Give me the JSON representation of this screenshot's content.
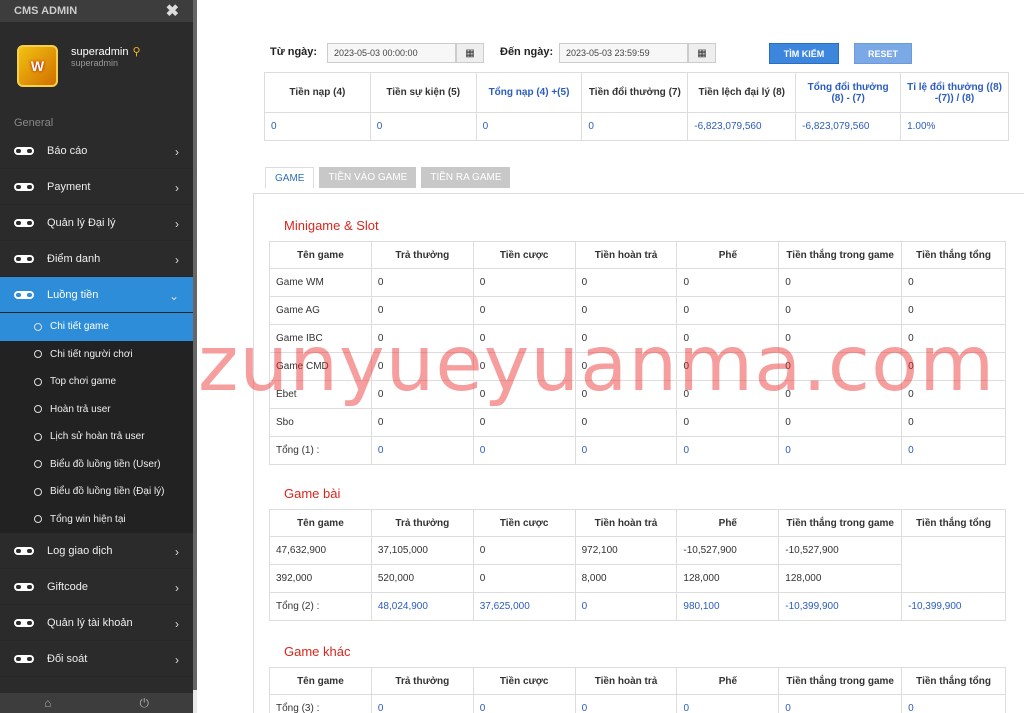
{
  "app": {
    "title": "CMS ADMIN",
    "close_icon": "✖"
  },
  "user": {
    "name": "superadmin",
    "role": "superadmin",
    "logo_text": "W",
    "key_icon": "key-icon"
  },
  "sidebar": {
    "section": "General",
    "items": [
      {
        "label": "Báo cáo"
      },
      {
        "label": "Payment"
      },
      {
        "label": "Quản lý Đại lý"
      },
      {
        "label": "Điểm danh"
      },
      {
        "label": "Luồng tiền"
      }
    ],
    "subitems": [
      {
        "label": "Chi tiết game"
      },
      {
        "label": "Chi tiết người chơi"
      },
      {
        "label": "Top chơi game"
      },
      {
        "label": "Hoàn trả user"
      },
      {
        "label": "Lịch sử hoàn trả user"
      },
      {
        "label": "Biểu đồ luồng tiền (User)"
      },
      {
        "label": "Biểu đồ luồng tiền (Đại lý)"
      },
      {
        "label": "Tổng win hiện tại"
      }
    ],
    "items2": [
      {
        "label": "Log giao dịch"
      },
      {
        "label": "Giftcode"
      },
      {
        "label": "Quản lý tài khoản"
      },
      {
        "label": "Đối soát"
      }
    ],
    "footer": {
      "home": "⌂",
      "power": "⏻"
    }
  },
  "filter": {
    "from_label": "Từ ngày:",
    "from_value": "2023-05-03 00:00:00",
    "to_label": "Đến ngày:",
    "to_value": "2023-05-03 23:59:59",
    "search_btn": "TÌM KIẾM",
    "reset_btn": "RESET",
    "cal_icon": "▦"
  },
  "summary": {
    "headers": [
      "Tiền nạp (4)",
      "Tiền sự kiện (5)",
      "Tổng nạp (4) +(5)",
      "Tiền đổi thưởng (7)",
      "Tiền lệch đại lý (8)",
      "Tổng đổi thưởng (8) - (7)",
      "Tỉ lệ đổi thưởng ((8) -(7)) / (8)"
    ],
    "values": [
      "0",
      "0",
      "0",
      "0",
      "-6,823,079,560",
      "-6,823,079,560",
      "1.00%"
    ]
  },
  "tabs": [
    "GAME",
    "TIỀN VÀO GAME",
    "TIỀN RA GAME"
  ],
  "columns": [
    "Tên game",
    "Trả thưởng",
    "Tiền cược",
    "Tiền hoàn trả",
    "Phế",
    "Tiền thắng trong game",
    "Tiền thắng tổng"
  ],
  "minigame": {
    "title": "Minigame & Slot",
    "rows": [
      [
        "Game WM",
        "0",
        "0",
        "0",
        "0",
        "0",
        "0"
      ],
      [
        "Game AG",
        "0",
        "0",
        "0",
        "0",
        "0",
        "0"
      ],
      [
        "Game IBC",
        "0",
        "0",
        "0",
        "0",
        "0",
        "0"
      ],
      [
        "Game CMD",
        "0",
        "0",
        "0",
        "0",
        "0",
        "0"
      ],
      [
        "Ebet",
        "0",
        "0",
        "0",
        "0",
        "0",
        "0"
      ],
      [
        "Sbo",
        "0",
        "0",
        "0",
        "0",
        "0",
        "0"
      ]
    ],
    "total": [
      "Tổng (1) :",
      "0",
      "0",
      "0",
      "0",
      "0",
      "0"
    ]
  },
  "gamebai": {
    "title": "Game bài",
    "rows": [
      [
        "47,632,900",
        "37,105,000",
        "0",
        "972,100",
        "-10,527,900",
        "-10,527,900"
      ],
      [
        "392,000",
        "520,000",
        "0",
        "8,000",
        "128,000",
        "128,000"
      ]
    ],
    "total": [
      "Tổng (2) :",
      "48,024,900",
      "37,625,000",
      "0",
      "980,100",
      "-10,399,900",
      "-10,399,900"
    ]
  },
  "gamekhac": {
    "title": "Game khác",
    "total": [
      "Tổng (3) :",
      "0",
      "0",
      "0",
      "0",
      "0",
      "0"
    ]
  },
  "watermark": "zunyueyuanma.com"
}
